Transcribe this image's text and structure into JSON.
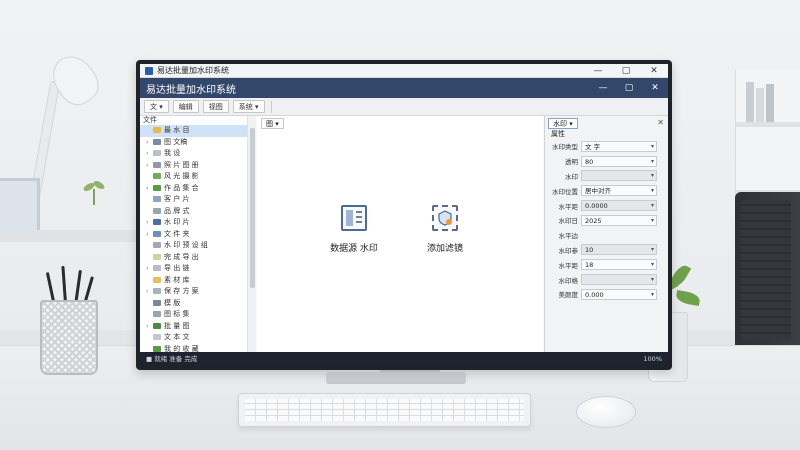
{
  "os_window": {
    "title": "易达批量加水印系统",
    "controls": [
      "—",
      "▢",
      "✕"
    ]
  },
  "app": {
    "title": "易达批量加水印系统",
    "controls": [
      "—",
      "▢",
      "✕"
    ]
  },
  "toolbar": {
    "buttons": [
      "文 ▾",
      "编辑",
      "视图",
      "系统 ▾"
    ],
    "view_dropdown": "图 ▾"
  },
  "tree": {
    "header": "文件",
    "items": [
      {
        "label": "最 水 目",
        "arrow": "",
        "icon_color": "#e8b84a",
        "selected": true
      },
      {
        "label": "图 文稿",
        "arrow": "›",
        "icon_color": "#7a8aa0"
      },
      {
        "label": "我 设",
        "arrow": "›",
        "icon_color": "#b9c0c8"
      },
      {
        "label": "照 片 图 册",
        "arrow": "›",
        "icon_color": "#8f9aa8"
      },
      {
        "label": "风 光 摄 影",
        "arrow": "",
        "icon_color": "#6fae55"
      },
      {
        "label": "作 品 集 合",
        "arrow": "›",
        "icon_color": "#5c9a48"
      },
      {
        "label": "客 户 片",
        "arrow": "",
        "icon_color": "#8aa4c8"
      },
      {
        "label": "品 牌 式",
        "arrow": "",
        "icon_color": "#9aa5b2"
      },
      {
        "label": "水 印 片",
        "arrow": "›",
        "icon_color": "#4a6fa5"
      },
      {
        "label": "文 件 夹",
        "arrow": "›",
        "icon_color": "#6f8fb8"
      },
      {
        "label": "水 印 预 设 组",
        "arrow": "",
        "icon_color": "#a0a8b2"
      },
      {
        "label": "完 成 导 出",
        "arrow": "",
        "icon_color": "#cbd3a0"
      },
      {
        "label": "导 出 链",
        "arrow": "›",
        "icon_color": "#b5bcc4"
      },
      {
        "label": "素 材 库",
        "arrow": "",
        "icon_color": "#e5c060"
      },
      {
        "label": "保 存 方 案",
        "arrow": "›",
        "icon_color": "#a9b1bb"
      },
      {
        "label": "模 版",
        "arrow": "",
        "icon_color": "#7b8797"
      },
      {
        "label": "图 标 集",
        "arrow": "",
        "icon_color": "#9aa3ae"
      },
      {
        "label": "批 量 图",
        "arrow": "›",
        "icon_color": "#4f8a3e"
      },
      {
        "label": "文 本 文",
        "arrow": "",
        "icon_color": "#c2c8cf"
      },
      {
        "label": "我 的 收 藏",
        "arrow": "",
        "icon_color": "#5a9a46"
      }
    ]
  },
  "canvas": {
    "dropdown": "图 ▾",
    "tiles": [
      {
        "label": "数据源 水印",
        "icon": "document-panel-icon"
      },
      {
        "label": "添加滤镜",
        "icon": "image-shield-icon"
      }
    ]
  },
  "props": {
    "dropdown": "水印 ▾",
    "section": "属性",
    "rows": [
      {
        "key": "水印类型",
        "value": "文 字",
        "dropdown": true,
        "gray": false
      },
      {
        "key": "透明",
        "value": "80",
        "dropdown": true,
        "gray": false
      },
      {
        "key": "水印",
        "value": "",
        "dropdown": true,
        "gray": true
      },
      {
        "key": "水印位置",
        "value": "居中对齐",
        "dropdown": true,
        "gray": false
      },
      {
        "key": "水平距",
        "value": "0.0000",
        "dropdown": true,
        "gray": true
      },
      {
        "key": "水印日",
        "value": "2025",
        "dropdown": true,
        "gray": false
      },
      {
        "key": "水平边",
        "value": "",
        "dropdown": false,
        "gray": false
      },
      {
        "key": "水印参",
        "value": "10",
        "dropdown": true,
        "gray": true
      },
      {
        "key": "水平距",
        "value": "18",
        "dropdown": true,
        "gray": false
      },
      {
        "key": "水印格",
        "value": "",
        "dropdown": true,
        "gray": true
      },
      {
        "key": "美颜度",
        "value": "0.000",
        "dropdown": true,
        "gray": false
      }
    ]
  },
  "statusbar": {
    "left": "■ 就绪 准备 完成",
    "right": "100%"
  }
}
